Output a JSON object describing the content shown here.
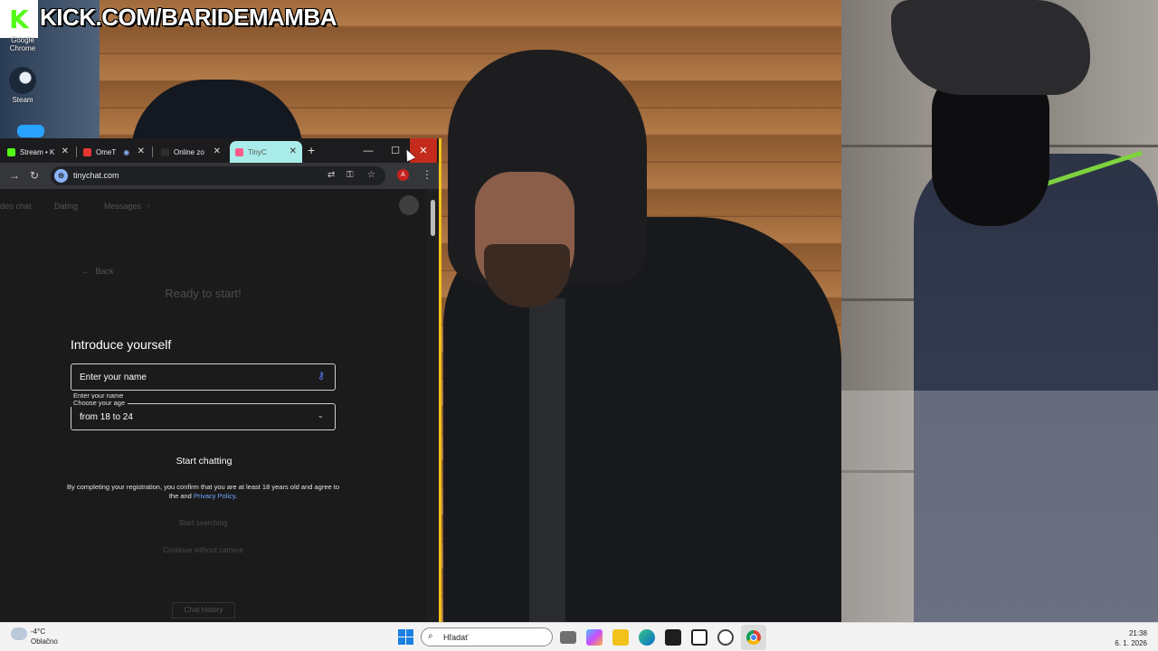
{
  "stream": {
    "logo_letter": "K",
    "url": "KICK.COM/BARIDEMAMBA"
  },
  "desktop_icons": [
    {
      "label": "Google\nChrome",
      "icon": "chrome-icon"
    },
    {
      "label": "Steam",
      "icon": "steam-icon"
    }
  ],
  "browser": {
    "tabs": [
      {
        "label": "Stream • K",
        "icon": "kick-icon",
        "active": false
      },
      {
        "label": "OmeT",
        "icon": "ometv-icon",
        "active": false
      },
      {
        "label": "Online zo",
        "icon": "blank-page-icon",
        "active": false
      },
      {
        "label": "TinyC",
        "icon": "tinychat-icon",
        "active": true
      }
    ],
    "new_tab": "+",
    "window_controls": {
      "minimize": "—",
      "maximize": "☐",
      "close": "✕"
    },
    "url": "tinychat.com",
    "profile_initial": "A"
  },
  "site": {
    "nav": [
      "deo chat",
      "Dating",
      "Messages"
    ],
    "back": "Back",
    "ready": "Ready to start!",
    "start_searching": "Start searching",
    "continue_without_camera": "Continue without camera",
    "chat_history": "Chat history"
  },
  "modal": {
    "title": "Introduce yourself",
    "name_field": {
      "value": "Enter your name",
      "label": "Enter your name"
    },
    "age_field": {
      "label": "Choose your age",
      "value": "from 18 to 24"
    },
    "start_button": "Start chatting",
    "consent_text": "By completing your registration, you confirm that you are at least 18 years old and agree to the and",
    "privacy_link": "Privacy Policy",
    "consent_end": "."
  },
  "taskbar": {
    "temperature": "-4°C",
    "condition": "Oblačno",
    "search_placeholder": "Hľadať",
    "time": "21:38",
    "date": "6. 1. 2026"
  }
}
